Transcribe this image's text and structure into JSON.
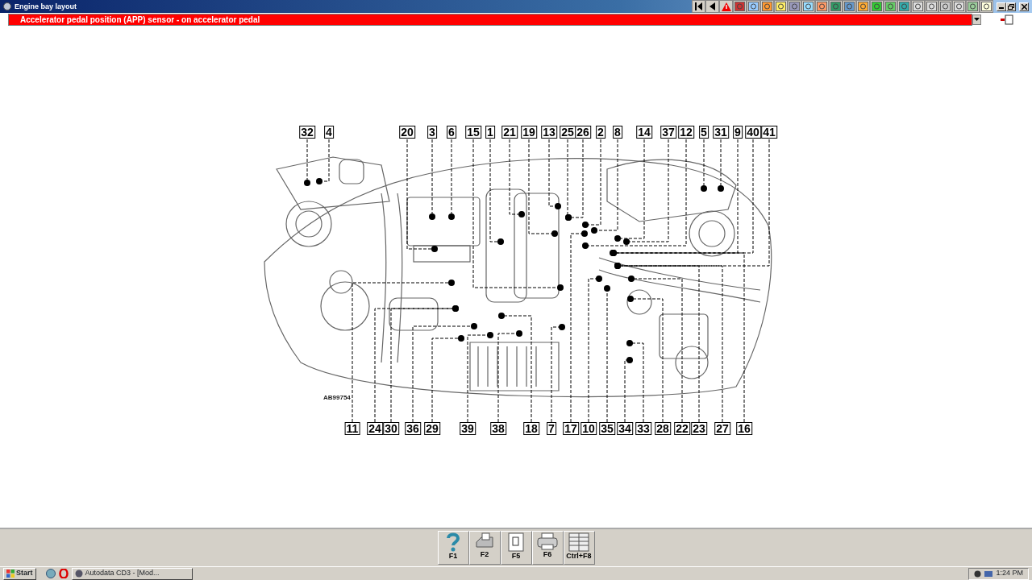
{
  "window": {
    "title": "Engine bay layout"
  },
  "selector": {
    "value": "Accelerator pedal position (APP) sensor - on accelerator pedal"
  },
  "diagram": {
    "reference": "AB99754",
    "top_callouts": [
      "32",
      "4",
      "20",
      "3",
      "6",
      "15",
      "1",
      "21",
      "19",
      "13",
      "25",
      "26",
      "2",
      "8",
      "14",
      "37",
      "12",
      "5",
      "31",
      "9",
      "40",
      "41"
    ],
    "bottom_callouts": [
      "11",
      "24",
      "30",
      "36",
      "29",
      "39",
      "38",
      "18",
      "7",
      "17",
      "10",
      "35",
      "34",
      "33",
      "28",
      "22",
      "23",
      "27",
      "16"
    ]
  },
  "function_keys": [
    {
      "kind": "help",
      "label": "F1"
    },
    {
      "kind": "fax",
      "label": "F2"
    },
    {
      "kind": "document",
      "label": "F5"
    },
    {
      "kind": "printer",
      "label": "F6"
    },
    {
      "kind": "table",
      "label": "Ctrl+F8"
    }
  ],
  "taskbar": {
    "start": "Start",
    "task": "Autodata CD3 - [Mod...",
    "clock": "1:24 PM"
  }
}
